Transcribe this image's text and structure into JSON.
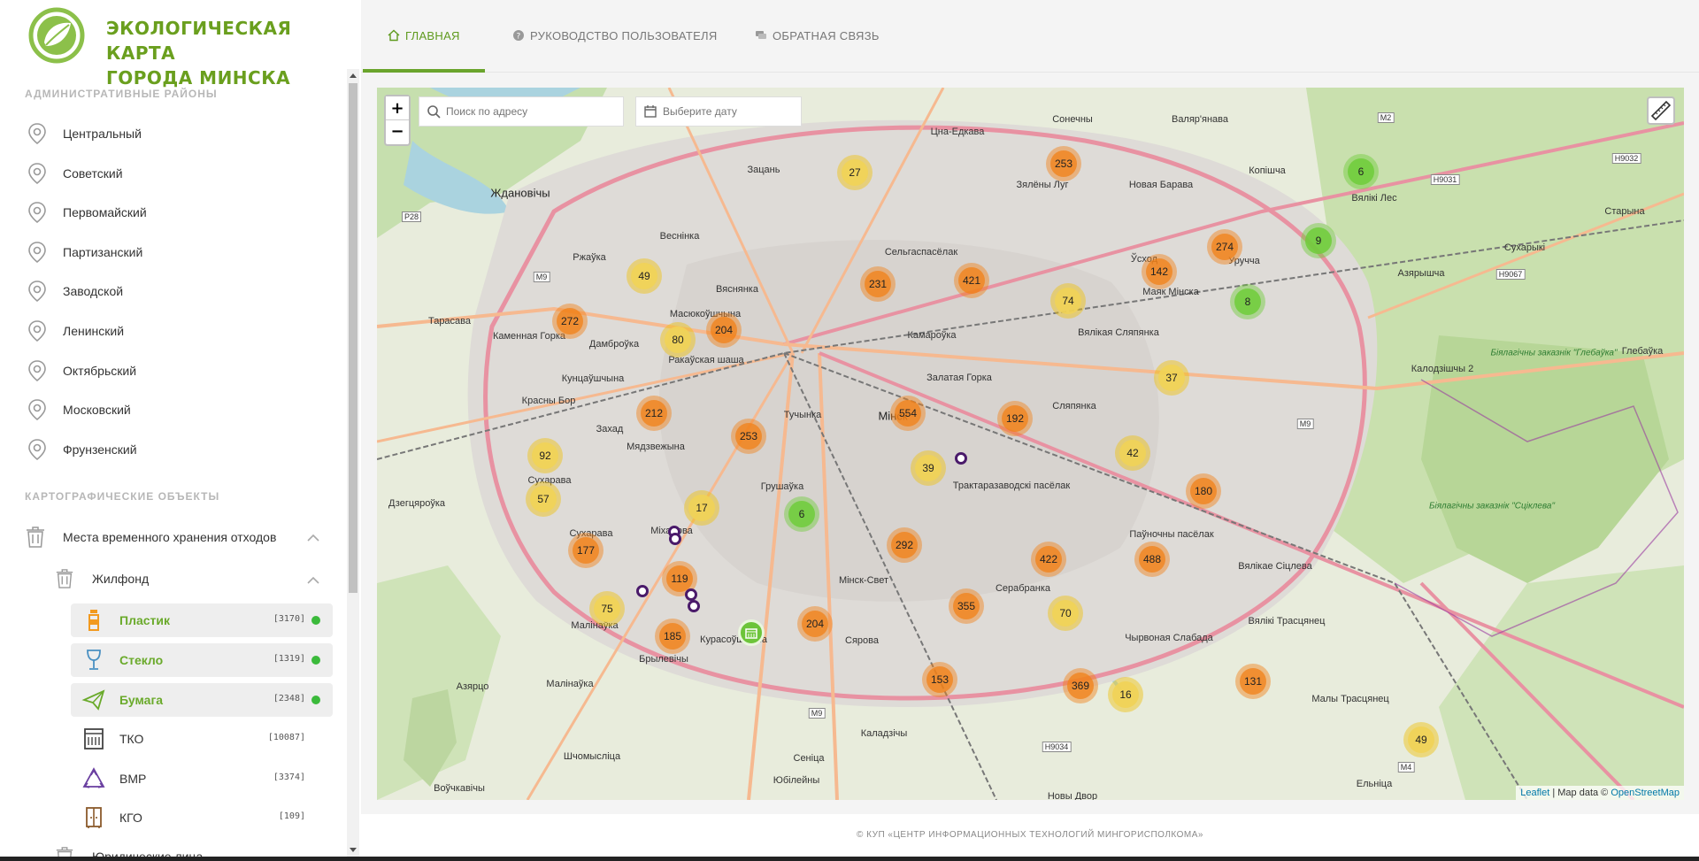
{
  "brand": {
    "title_line1": "ЭКОЛОГИЧЕСКАЯ КАРТА",
    "title_line2": "ГОРОДА МИНСКА",
    "accent": "#6a9f1e"
  },
  "sidebar": {
    "districts_title": "АДМИНИСТРАТИВНЫЕ РАЙОНЫ",
    "districts": [
      {
        "label": "Центральный"
      },
      {
        "label": "Советский"
      },
      {
        "label": "Первомайский"
      },
      {
        "label": "Партизанский"
      },
      {
        "label": "Заводской"
      },
      {
        "label": "Ленинский"
      },
      {
        "label": "Октябрьский"
      },
      {
        "label": "Московский"
      },
      {
        "label": "Фрунзенский"
      }
    ],
    "objects_title": "КАРТОГРАФИЧЕСКИЕ ОБЪЕКТЫ",
    "group": {
      "label": "Места временного хранения отходов"
    },
    "subgroup": {
      "label": "Жилфонд"
    },
    "waste_types": [
      {
        "label": "Пластик",
        "count": "[3170]",
        "active": true,
        "icon": "bottle-icon"
      },
      {
        "label": "Стекло",
        "count": "[1319]",
        "active": true,
        "icon": "glass-icon"
      },
      {
        "label": "Бумага",
        "count": "[2348]",
        "active": true,
        "icon": "paper-plane-icon"
      },
      {
        "label": "ТКО",
        "count": "[10087]",
        "active": false,
        "icon": "container-icon"
      },
      {
        "label": "ВМР",
        "count": "[3374]",
        "active": false,
        "icon": "recycle-icon"
      },
      {
        "label": "КГО",
        "count": "[109]",
        "active": false,
        "icon": "cabinet-icon"
      }
    ],
    "next_group": {
      "label": "Юридические лица"
    }
  },
  "nav": {
    "tabs": [
      {
        "label": "ГЛАВНАЯ",
        "icon": "home-icon",
        "active": true
      },
      {
        "label": "РУКОВОДСТВО ПОЛЬЗОВАТЕЛЯ",
        "icon": "help-icon",
        "active": false
      },
      {
        "label": "ОБРАТНАЯ СВЯЗЬ",
        "icon": "chat-icon",
        "active": false
      }
    ]
  },
  "map": {
    "search_placeholder": "Поиск по адресу",
    "date_placeholder": "Выберите дату",
    "zoom_in": "+",
    "zoom_out": "−",
    "attribution_leaflet": "Leaflet",
    "attribution_text": " | Map data © ",
    "attribution_osm": "OpenStreetMap",
    "labels": {
      "zhdanovichi": "Ждановічы",
      "vesninka": "Веснінка",
      "zacan": "Зацань",
      "cna": "Цна-Едкава",
      "sonechny": "Сонечны",
      "valeryanava": "Валяр'янава",
      "zyaleny": "Зялёны Луг",
      "navabarava": "Новая Барава",
      "kopishcha": "Копішча",
      "vyalikiles": "Вялікі Лес",
      "staryna": "Старына",
      "sukharyki": "Сухарыкі",
      "azyaryshcha": "Азярышча",
      "tarasava": "Тарасава",
      "rzhavka": "Ржаўка",
      "vyasnyanka": "Вяснянка",
      "kamennaya": "Каменная Горка",
      "dambrouka": "Дамброўка",
      "masyukoushchyna": "Масюкоўшчына",
      "rakauskaya": "Ракаўская шаша",
      "selgas": "Сельгаспасёлак",
      "kamarouka": "Камароўка",
      "usxod": "Ўсход",
      "mayak": "Маяк Мінска",
      "uruchcha": "Уручча",
      "vyalikaya": "Вялікая Сляпянка",
      "kuncaushchyna": "Кунцаўшчына",
      "krasny": "Красны Бор",
      "zakhad": "Захад",
      "tuchynka": "Тучынка",
      "myadzvyazhyna": "Мядзвежына",
      "zalataya": "Залатая Горка",
      "minsk": "Мінск",
      "slyapyanka": "Сляпянка",
      "sukharava": "Сухарава",
      "dzyarzhyna": "Дзегцярoўка",
      "grushauka": "Грушаўка",
      "traktarazavodski": "Трактаразаводскі пасёлак",
      "payunochny": "Паўночны пасёлак",
      "vyalikaesiclyeva": "Вялікае Сіцлева",
      "mikhalova": "Міхалова",
      "sukhareva2": "Сухарава",
      "minskswet": "Мінск-Свет",
      "serabranka": "Серабранка",
      "vyalikitrascyanec": "Вялікі Трасцянец",
      "malinauka": "Малінаўка",
      "brylevichy": "Брылевічы",
      "krasouschyna": "Курасоўшчына",
      "syarova": "Сярова",
      "chyrvonaya": "Чырвоная Слабада",
      "malyyatrascyanec": "Малы Трасцянец",
      "azyarco": "Азярцо",
      "malinouka2": "Малінаўка",
      "shchomyslicya": "Шчомысліца",
      "kaladzishchy": "Калодзішчы 2",
      "glebouka": "Глебаўка",
      "yubileyny": "Юбілейны",
      "sencica": "Сеніца",
      "nowy": "Новы Двор",
      "voychkov": "Воўчкавічы",
      "elnica": "Ельніца",
      "kaladziy": "Каладзічы",
      "zakaz": "Біялагічны заказнік \"Глебаўка\"",
      "zakaz2": "Біялагічны заказнік \"Сціклева\""
    },
    "roads": {
      "m2": "M2",
      "m9a": "M9",
      "m9b": "M9",
      "m9c": "M9",
      "p28": "P28",
      "m4": "M4",
      "h9031": "H9031",
      "h9032": "H9032",
      "h9067": "H9067",
      "h9034": "H9034"
    },
    "clusters": [
      {
        "value": "27",
        "color": "yellow"
      },
      {
        "value": "253",
        "color": "orange"
      },
      {
        "value": "6",
        "color": "green"
      },
      {
        "value": "274",
        "color": "orange"
      },
      {
        "value": "9",
        "color": "green"
      },
      {
        "value": "8",
        "color": "green"
      },
      {
        "value": "142",
        "color": "orange"
      },
      {
        "value": "49",
        "color": "yellow"
      },
      {
        "value": "231",
        "color": "orange"
      },
      {
        "value": "421",
        "color": "orange"
      },
      {
        "value": "74",
        "color": "yellow"
      },
      {
        "value": "272",
        "color": "orange"
      },
      {
        "value": "80",
        "color": "yellow"
      },
      {
        "value": "204",
        "color": "orange"
      },
      {
        "value": "37",
        "color": "yellow"
      },
      {
        "value": "212",
        "color": "orange"
      },
      {
        "value": "554",
        "color": "orange"
      },
      {
        "value": "192",
        "color": "orange"
      },
      {
        "value": "92",
        "color": "yellow"
      },
      {
        "value": "253",
        "color": "orange"
      },
      {
        "value": "39",
        "color": "yellow"
      },
      {
        "value": "42",
        "color": "yellow"
      },
      {
        "value": "57",
        "color": "yellow"
      },
      {
        "value": "17",
        "color": "yellow"
      },
      {
        "value": "6",
        "color": "green"
      },
      {
        "value": "180",
        "color": "orange"
      },
      {
        "value": "177",
        "color": "orange"
      },
      {
        "value": "292",
        "color": "orange"
      },
      {
        "value": "422",
        "color": "orange"
      },
      {
        "value": "488",
        "color": "orange"
      },
      {
        "value": "119",
        "color": "orange"
      },
      {
        "value": "75",
        "color": "yellow"
      },
      {
        "value": "355",
        "color": "orange"
      },
      {
        "value": "70",
        "color": "yellow"
      },
      {
        "value": "185",
        "color": "orange"
      },
      {
        "value": "204",
        "color": "orange"
      },
      {
        "value": "153",
        "color": "orange"
      },
      {
        "value": "369",
        "color": "orange"
      },
      {
        "value": "16",
        "color": "yellow"
      },
      {
        "value": "131",
        "color": "orange"
      },
      {
        "value": "49",
        "color": "yellow"
      }
    ]
  },
  "footer": {
    "text": "© КУП «ЦЕНТР ИНФОРМАЦИОННЫХ ТЕХНОЛОГИЙ МИНГОРИСПОЛКОМА»"
  }
}
